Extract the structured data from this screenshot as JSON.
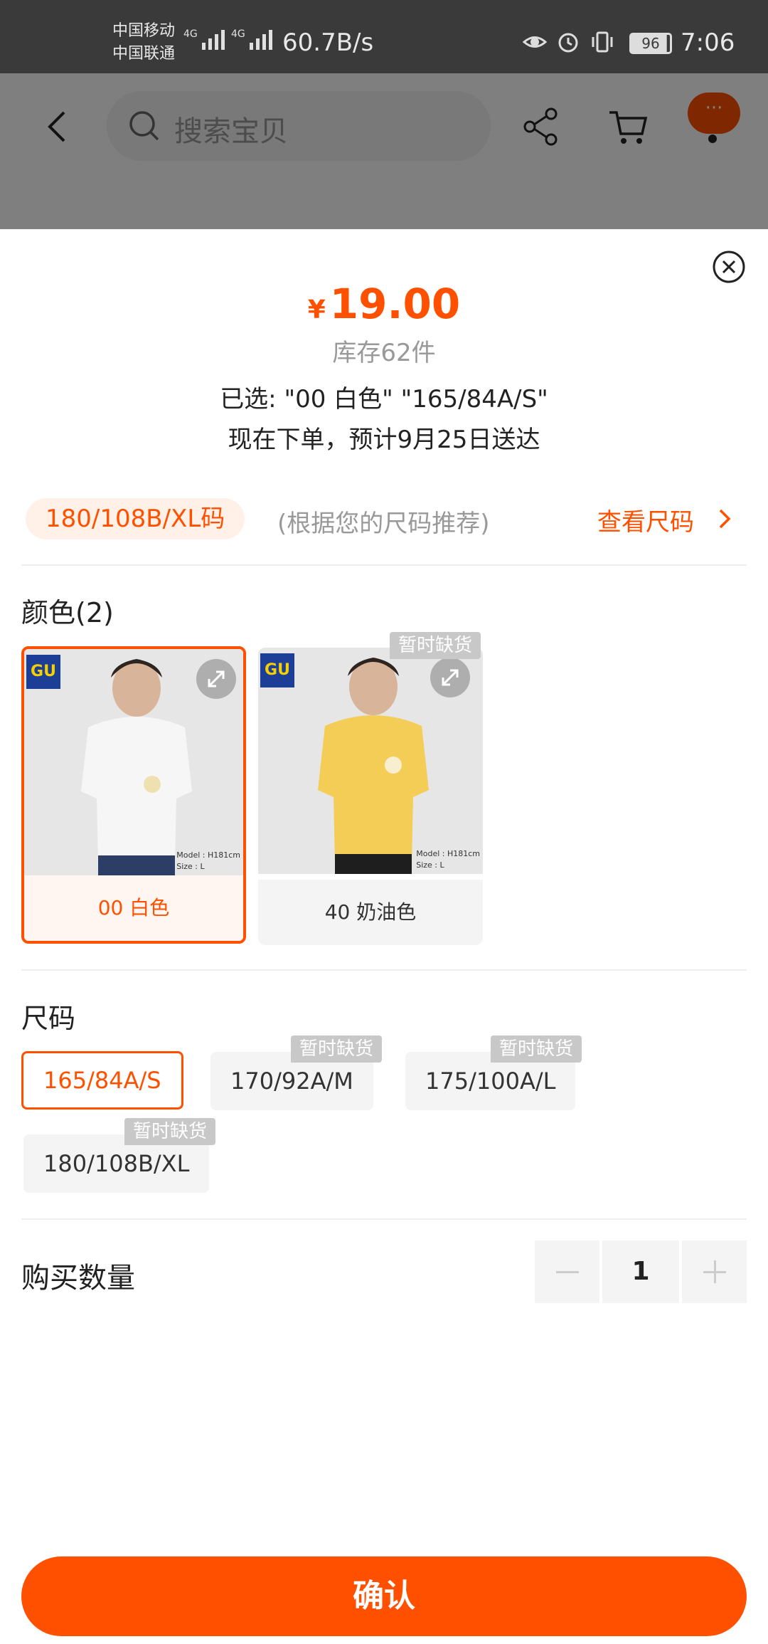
{
  "status_bar": {
    "carrier1": "中国移动",
    "carrier2": "中国联通",
    "net_label1": "4G",
    "net_label2": "4G",
    "net_speed": "60.7B/s",
    "battery": "96",
    "time": "7:06"
  },
  "nav": {
    "search_placeholder": "搜索宝贝",
    "more_label": "···"
  },
  "product": {
    "currency": "¥",
    "price": "19.00",
    "stock": "库存62件",
    "selected": "已选: \"00 白色\" \"165/84A/S\"",
    "delivery": "现在下单，预计9月25日送达"
  },
  "recommend": {
    "size": "180/108B/XL码",
    "note": "(根据您的尺码推荐)",
    "link": "查看尺码"
  },
  "colors": {
    "title": "颜色(2)",
    "items": [
      {
        "name": "00 白色",
        "shirt_color": "#f6f6f6",
        "model_text": "Model : H181cm\nSize : L",
        "logo": "GU"
      },
      {
        "name": "40 奶油色",
        "shirt_color": "#f4cd57",
        "model_text": "Model : H181cm\nSize : L",
        "logo": "GU",
        "badge": "暂时缺货"
      }
    ]
  },
  "sizes": {
    "title": "尺码",
    "items": [
      {
        "label": "165/84A/S"
      },
      {
        "label": "170/92A/M",
        "badge": "暂时缺货"
      },
      {
        "label": "175/100A/L",
        "badge": "暂时缺货"
      },
      {
        "label": "180/108B/XL",
        "badge": "暂时缺货"
      }
    ]
  },
  "quantity": {
    "label": "购买数量",
    "value": "1"
  },
  "confirm_label": "确认",
  "colors_accent": {
    "brand": "#ff5000"
  }
}
